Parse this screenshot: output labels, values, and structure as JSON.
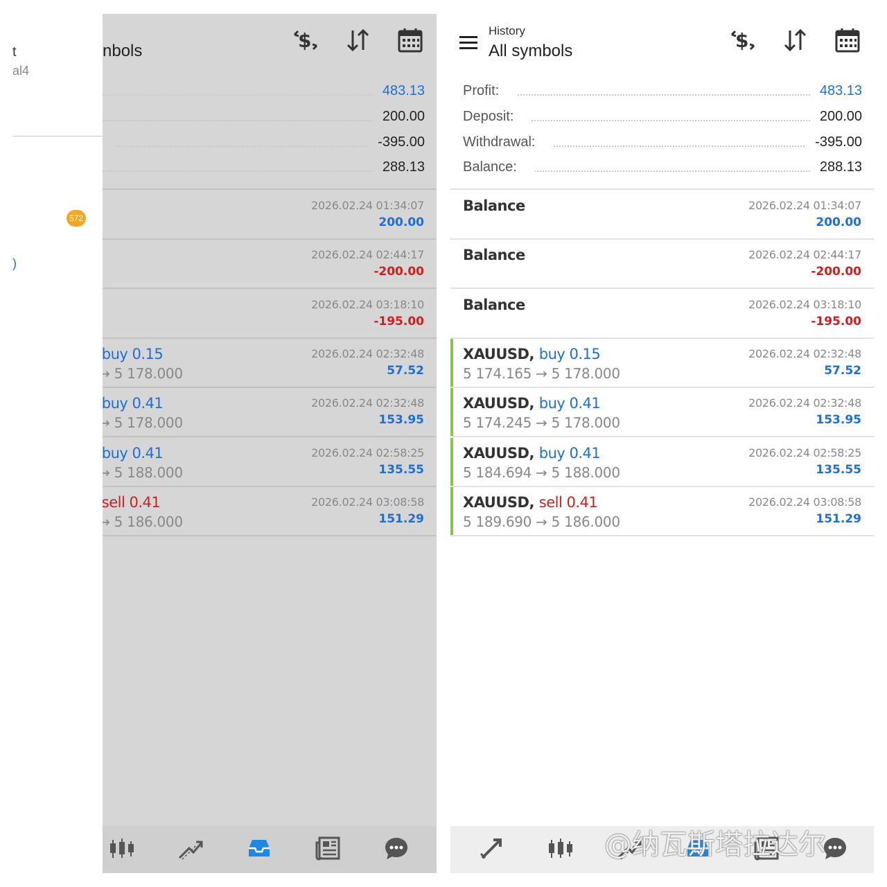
{
  "drawer_peek": {
    "title_char": "t",
    "subtitle": "al4",
    "badge": "572",
    "paren": ")"
  },
  "header": {
    "small": "History",
    "title": "All symbols",
    "left_title": "nbols"
  },
  "summary": [
    {
      "label": "Profit:",
      "value": "483.13",
      "color": "blue"
    },
    {
      "label": "Deposit:",
      "value": "200.00",
      "color": "default"
    },
    {
      "label": "Withdrawal:",
      "value": "-395.00",
      "color": "default"
    },
    {
      "label": "Balance:",
      "value": "288.13",
      "color": "default"
    }
  ],
  "rows": [
    {
      "type": "balance",
      "title": "Balance",
      "time": "2026.02.24 01:34:07",
      "amount": "200.00",
      "amount_color": "blue"
    },
    {
      "type": "balance",
      "title": "Balance",
      "time": "2026.02.24 02:44:17",
      "amount": "-200.00",
      "amount_color": "red"
    },
    {
      "type": "balance",
      "title": "Balance",
      "time": "2026.02.24 03:18:10",
      "amount": "-195.00",
      "amount_color": "red"
    },
    {
      "type": "deal",
      "symbol": "XAUUSD,",
      "dir": "buy 0.15",
      "dir_color": "blue",
      "prices": "5 174.165 → 5 178.000",
      "time": "2026.02.24 02:32:48",
      "amount": "57.52",
      "amount_color": "blue"
    },
    {
      "type": "deal",
      "symbol": "XAUUSD,",
      "dir": "buy 0.41",
      "dir_color": "blue",
      "prices": "5 174.245 → 5 178.000",
      "time": "2026.02.24 02:32:48",
      "amount": "153.95",
      "amount_color": "blue"
    },
    {
      "type": "deal",
      "symbol": "XAUUSD,",
      "dir": "buy 0.41",
      "dir_color": "blue",
      "prices": "5 184.694 → 5 188.000",
      "time": "2026.02.24 02:58:25",
      "amount": "135.55",
      "amount_color": "blue"
    },
    {
      "type": "deal",
      "symbol": "XAUUSD,",
      "dir": "sell 0.41",
      "dir_color": "red",
      "prices": "5 189.690 → 5 186.000",
      "time": "2026.02.24 03:08:58",
      "amount": "151.29",
      "amount_color": "blue"
    }
  ],
  "icons": {
    "header": [
      "dollar-exchange-icon",
      "sort-icon",
      "calendar-icon"
    ],
    "nav_left": [
      "candlestick-chart-icon",
      "trade-icon",
      "history-inbox-icon",
      "news-icon",
      "chat-icon"
    ],
    "nav_right": [
      "quotes-icon",
      "candlestick-chart-icon",
      "trade-icon",
      "history-inbox-icon",
      "news-icon",
      "chat-icon"
    ]
  },
  "colors": {
    "blue": "#1e6fd0",
    "red": "#cc1f1f",
    "accent": "#8bc34a",
    "active_nav": "#1e88e5"
  },
  "watermark": "@纳瓦斯塔拉达尔"
}
